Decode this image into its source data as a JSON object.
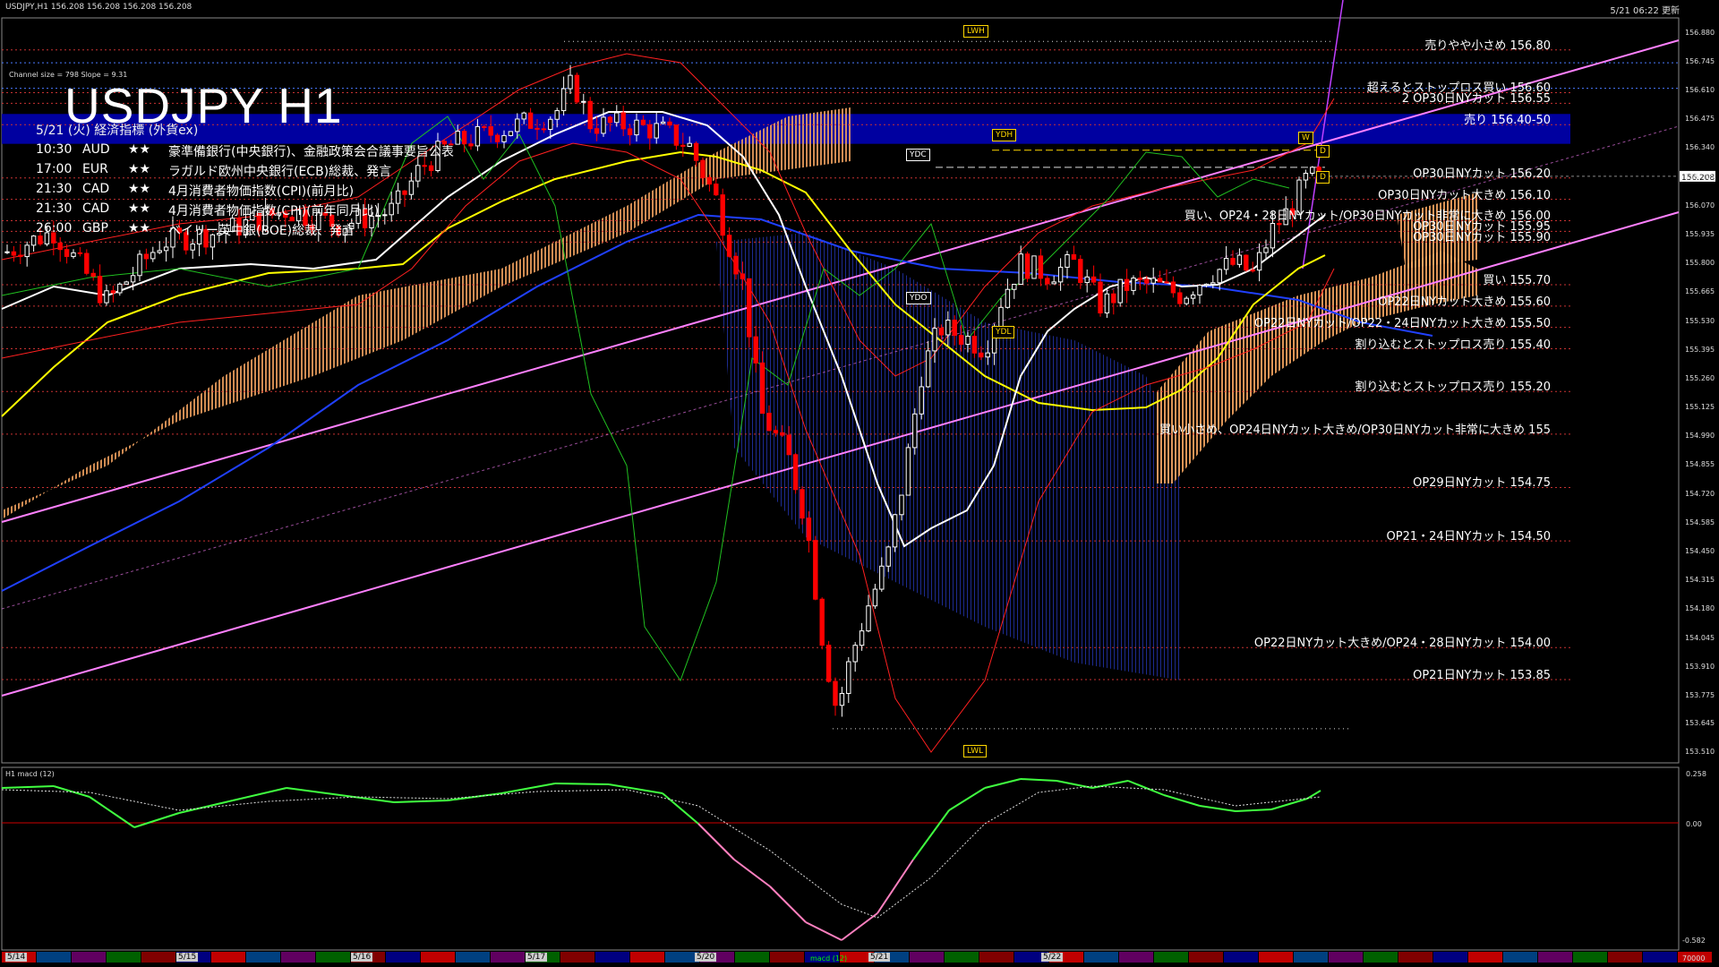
{
  "header": {
    "symbol_info": "USDJPY,H1  156.208 156.208 156.208 156.208",
    "datetime": "5/21 06:22 更新",
    "channel_info": "Channel size = 798 Slope = 9.31",
    "title": "USDJPY H1"
  },
  "events": {
    "title": "5/21 (火) 経済指標 (外貨ex)",
    "items": [
      {
        "time": "10:30",
        "currency": "AUD",
        "stars": "★★",
        "text": "豪準備銀行(中央銀行)、金融政策会合議事要旨公表"
      },
      {
        "time": "17:00",
        "currency": "EUR",
        "stars": "★★",
        "text": "ラガルド欧州中央銀行(ECB)総裁、発言"
      },
      {
        "time": "21:30",
        "currency": "CAD",
        "stars": "★★",
        "text": "4月消費者物価指数(CPI)(前月比)"
      },
      {
        "time": "21:30",
        "currency": "CAD",
        "stars": "★★",
        "text": "4月消費者物価指数(CPI)(前年同月比)"
      },
      {
        "time": "26:00",
        "currency": "GBP",
        "stars": "★★",
        "text": "ベイリー英中銀(BOE)総裁、発言"
      }
    ]
  },
  "levels": [
    {
      "text": "売りやや小さめ 156.80",
      "price": 156.8
    },
    {
      "text": "超えるとストップロス買い 156.60",
      "price": 156.6
    },
    {
      "text": "2  OP30日NYカット 156.55",
      "price": 156.55
    },
    {
      "text": "売り 156.40-50",
      "price": 156.45
    },
    {
      "text": "OP30日NYカット 156.20",
      "price": 156.2
    },
    {
      "text": "OP30日NYカット大きめ 156.10",
      "price": 156.1
    },
    {
      "text": "買い、OP24・28日NYカット/OP30日NYカット非常に大きめ 156.00",
      "price": 156.0
    },
    {
      "text": "OP30日NYカット 155.95",
      "price": 155.95
    },
    {
      "text": "OP30日NYカット 155.90",
      "price": 155.9
    },
    {
      "text": "買い 155.70",
      "price": 155.7
    },
    {
      "text": "OP22日NYカット大きめ 155.60",
      "price": 155.6
    },
    {
      "text": "OP22日NYカット/OP22・24日NYカット大きめ 155.50",
      "price": 155.5
    },
    {
      "text": "割り込むとストップロス売り 155.40",
      "price": 155.4
    },
    {
      "text": "割り込むとストップロス売り 155.20",
      "price": 155.2
    },
    {
      "text": "買い小さめ、OP24日NYカット大きめ/OP30日NYカット非常に大きめ 155",
      "price": 155.0
    },
    {
      "text": "OP29日NYカット 154.75",
      "price": 154.75
    },
    {
      "text": "OP21・24日NYカット 154.50",
      "price": 154.5
    },
    {
      "text": "OP22日NYカット大きめ/OP24・28日NYカット 154.00",
      "price": 154.0
    },
    {
      "text": "OP21日NYカット 153.85",
      "price": 153.85
    }
  ],
  "markers": {
    "lwh": "LWH",
    "lwl": "LWL",
    "ydh": "YDH",
    "ydl": "YDL",
    "ydc": "YDC",
    "ydo": "YDO",
    "w": "W",
    "d": "D"
  },
  "price_axis": [
    "156.880",
    "156.745",
    "156.610",
    "156.475",
    "156.340",
    "156.205",
    "156.070",
    "155.935",
    "155.800",
    "155.665",
    "155.530",
    "155.395",
    "155.260",
    "155.125",
    "154.990",
    "154.855",
    "154.720",
    "154.585",
    "154.450",
    "154.315",
    "154.180",
    "154.045",
    "153.910",
    "153.775",
    "153.645",
    "153.510"
  ],
  "current_price": "156.208",
  "macd": {
    "label": "H1  macd (12)",
    "axis": [
      "0.258",
      "0.00",
      "-0.582",
      "70000"
    ],
    "tag": "macd (12)"
  },
  "dates": [
    "5/14",
    "5/15",
    "5/16",
    "5/17",
    "5/20",
    "5/21",
    "5/22"
  ],
  "colors": {
    "background": "#000000",
    "bull_candle": "#ffffff",
    "bear_candle": "#ff0000",
    "trend_line": "#ff80ff",
    "sell_zone": "#0000a0",
    "ma_white": "#ffffff",
    "ma_yellow": "#ffff00",
    "ma_blue": "#2040ff",
    "macd_line": "#40ff40",
    "level_dotted": "#c83232"
  }
}
